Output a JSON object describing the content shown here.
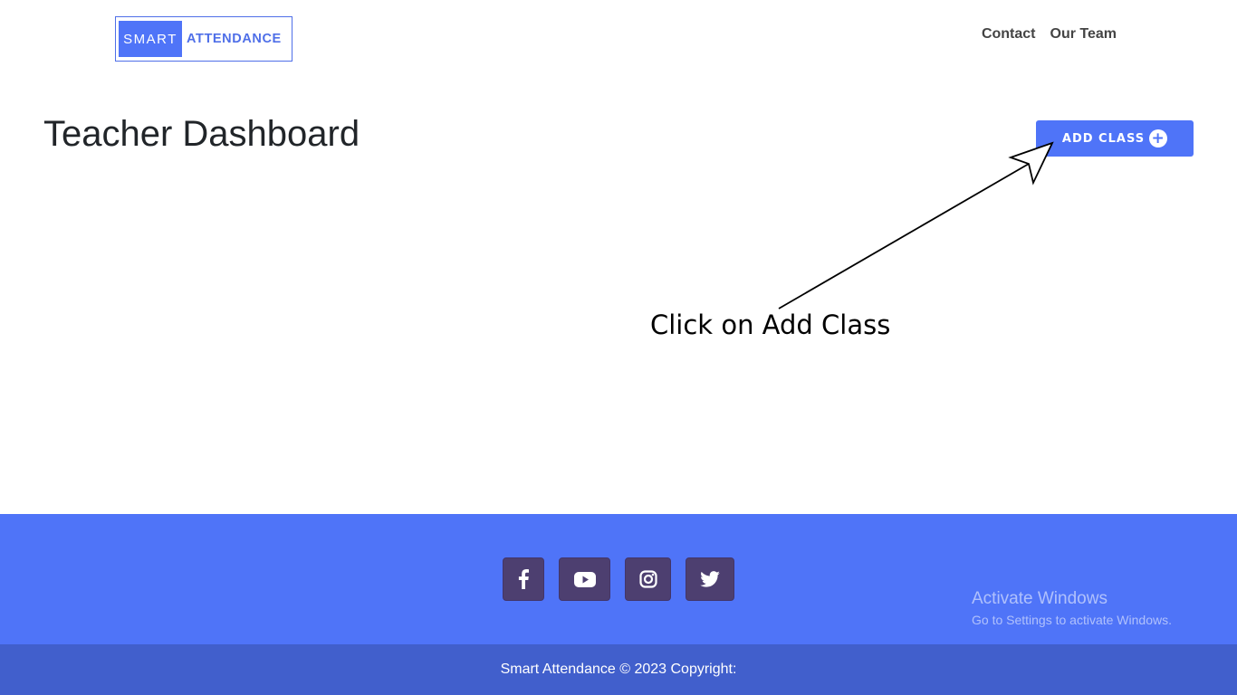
{
  "header": {
    "logo": {
      "part1": "SMART",
      "part2": "ATTENDANCE"
    },
    "nav": [
      {
        "label": "Contact"
      },
      {
        "label": "Our Team"
      }
    ]
  },
  "main": {
    "title": "Teacher Dashboard",
    "add_class_label": "ADD CLASS",
    "add_class_icon": "plus-circle-icon"
  },
  "annotation": {
    "text": "Click on Add Class"
  },
  "footer": {
    "social": [
      {
        "icon": "facebook-icon"
      },
      {
        "icon": "youtube-icon"
      },
      {
        "icon": "instagram-icon"
      },
      {
        "icon": "twitter-icon"
      }
    ],
    "copyright": "Smart Attendance © 2023 Copyright:",
    "watermark": {
      "title": "Activate Windows",
      "subtitle": "Go to Settings to activate Windows."
    }
  },
  "colors": {
    "brand": "#4f74f8",
    "footer_bottom": "#415fcc",
    "social_bg": "#4d3f70"
  }
}
